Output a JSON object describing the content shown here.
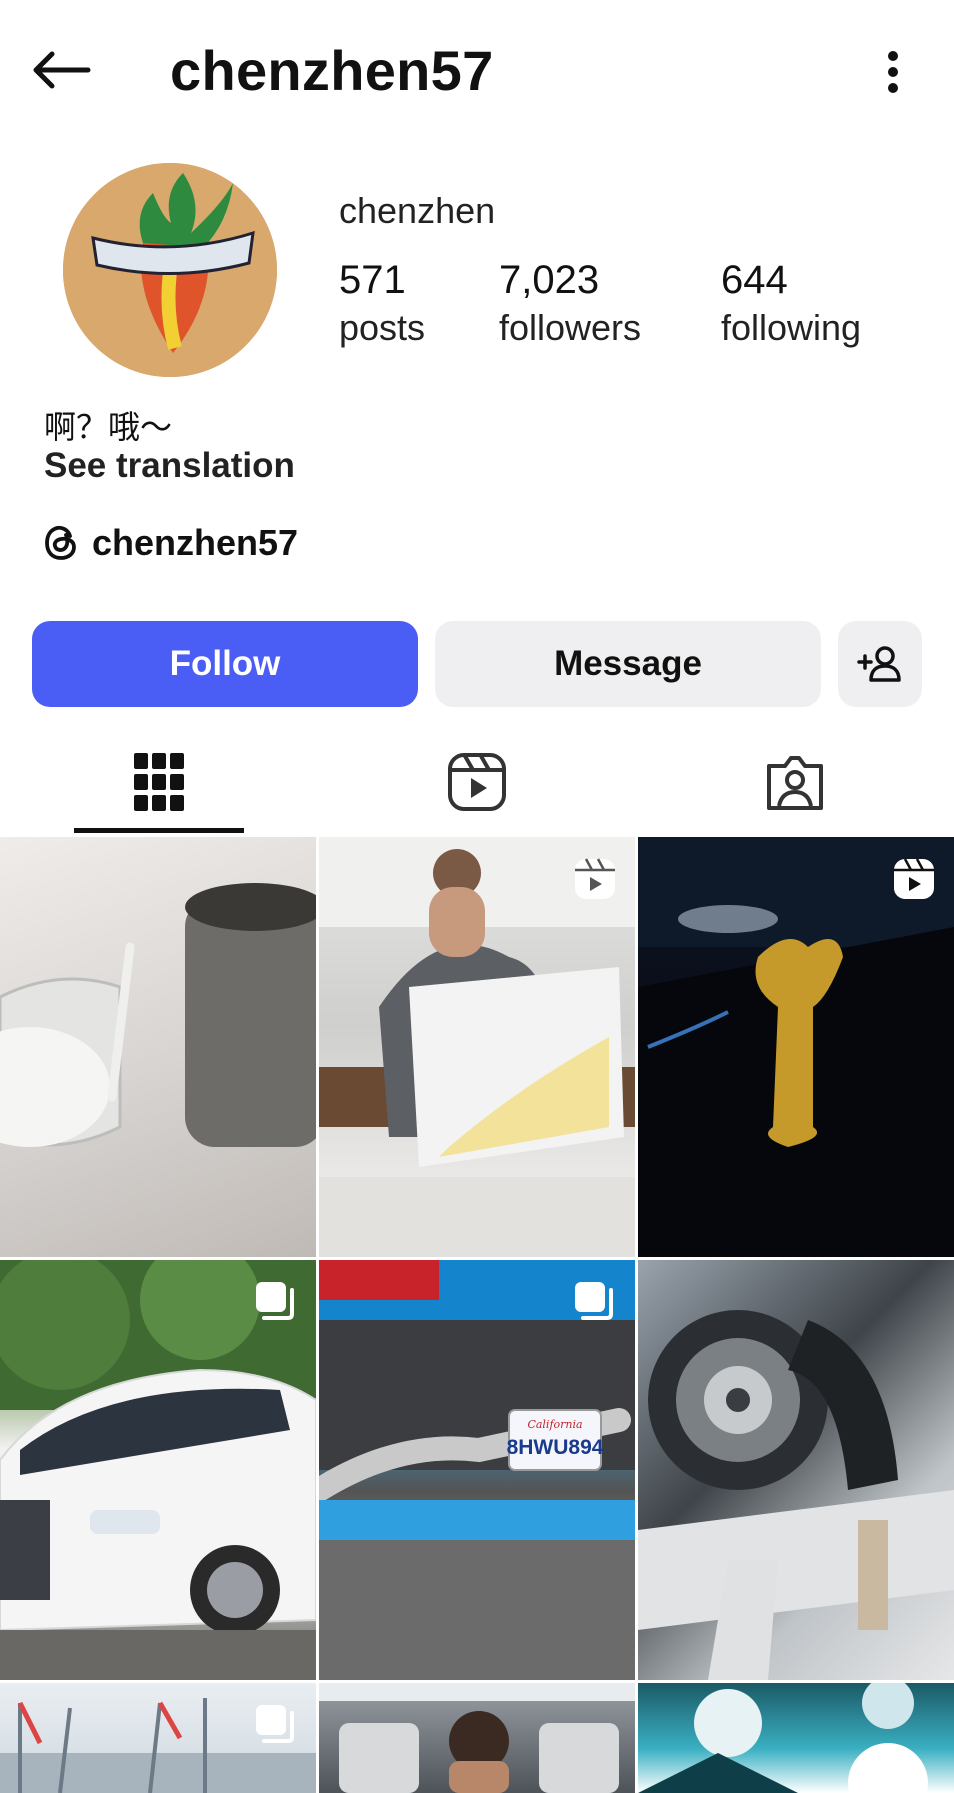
{
  "header": {
    "username": "chenzhen57",
    "back_icon": "arrow-left-icon",
    "more_icon": "vertical-dots-icon"
  },
  "profile": {
    "full_name": "chenzhen",
    "avatar": "avatar-image",
    "stats": {
      "posts": {
        "value": "571",
        "label": "posts"
      },
      "followers": {
        "value": "7,023",
        "label": "followers"
      },
      "following": {
        "value": "644",
        "label": "following"
      }
    },
    "bio": "啊？哦～",
    "see_translation": "See translation",
    "threads_handle": "chenzhen57",
    "threads_icon": "threads-icon"
  },
  "actions": {
    "follow_label": "Follow",
    "message_label": "Message",
    "add_user_icon": "add-user-icon",
    "accent": "#4a5df5"
  },
  "tabs": [
    {
      "name": "grid",
      "icon": "grid-icon",
      "active": true
    },
    {
      "name": "reels",
      "icon": "reels-icon",
      "active": false
    },
    {
      "name": "tagged",
      "icon": "tagged-user-icon",
      "active": false
    }
  ],
  "posts": [
    {
      "badge": "none"
    },
    {
      "badge": "reel-icon"
    },
    {
      "badge": "reel-icon"
    },
    {
      "badge": "carousel-icon"
    },
    {
      "badge": "carousel-icon"
    },
    {
      "badge": "none"
    },
    {
      "badge": "carousel-icon"
    },
    {
      "badge": "none"
    },
    {
      "badge": "none"
    }
  ],
  "post_texts": {
    "license_plate_state": "California",
    "license_plate_number": "8HWU894"
  }
}
